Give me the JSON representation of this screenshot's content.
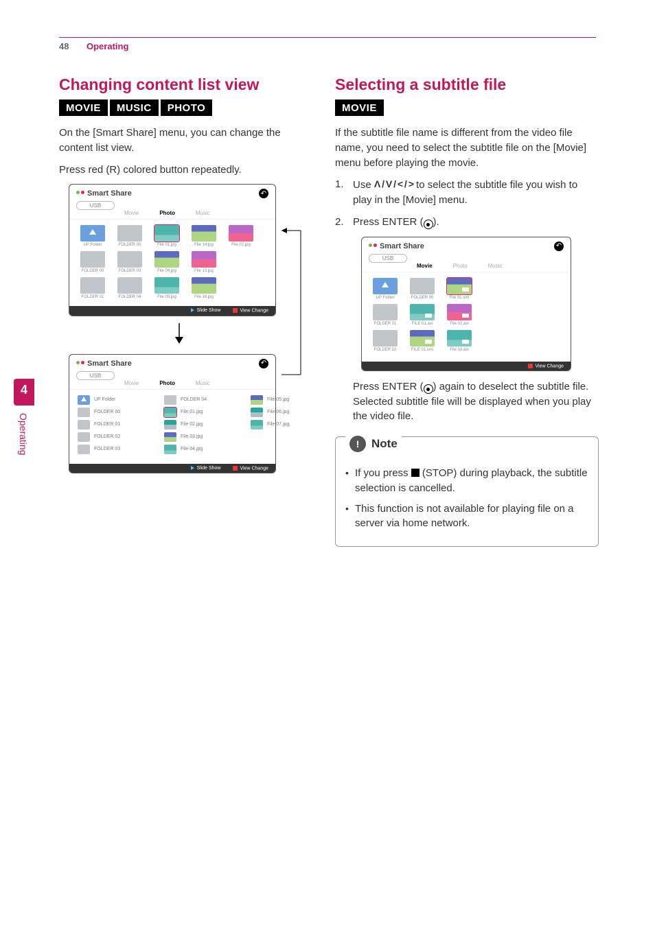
{
  "header": {
    "page": "48",
    "category": "Operating"
  },
  "sidebar": {
    "num": "4",
    "label": "Operating"
  },
  "left": {
    "title": "Changing content list view",
    "tags": [
      "MOVIE",
      "MUSIC",
      "PHOTO"
    ],
    "p1": "On the [Smart Share] menu, you can change the content list view.",
    "p2": "Press red (R) colored button repeatedly."
  },
  "right": {
    "title": "Selecting a subtitle file",
    "tags": [
      "MOVIE"
    ],
    "p1": "If the subtitle file name is different from the video file name, you need to select the subtitle file on the [Movie] menu before playing the movie.",
    "step1a": "Use ",
    "step1_dpad": "Λ / V / < / >",
    "step1b": " to select the subtitle file you wish to play in the [Movie] menu.",
    "step2a": "Press ENTER (",
    "step2b": ").",
    "after1a": "Press ENTER (",
    "after1b": ") again to deselect the subtitle file. Selected subtitle file will be displayed when you play the video file.",
    "note_label": "Note",
    "note1a": "If you press ",
    "note1b": " (STOP) during playback, the subtitle selection is cancelled.",
    "note2": "This function is not available for playing file on a server via home network."
  },
  "ss_common": {
    "title": "Smart Share",
    "usb": "USB",
    "tab_movie": "Movie",
    "tab_photo": "Photo",
    "tab_music": "Music",
    "footer_slide": "Slide Show",
    "footer_change": "View Change"
  },
  "ss1_labels": {
    "up": "UP Folder",
    "f00": "FOLDER 00",
    "f01": "File 01.jpg",
    "f02": "File 14.jpg",
    "f03": "File 07.jpg",
    "r2a": "FOLDER 00",
    "r2b": "FOLDER 03",
    "r2c": "File 04.jpg",
    "r2d": "File 13.jpg",
    "r3a": "FOLDER 01",
    "r3b": "FOLDER 04",
    "r3c": "File 05.jpg",
    "r3d": "File 16.jpg"
  },
  "ss2_labels": {
    "c1": [
      "UP Folder",
      "FOLDER 00",
      "FOLDER 01",
      "FOLDER 02",
      "FOLDER 03"
    ],
    "c2": [
      "FOLDER 04",
      "File 01.jpg",
      "File 02.jpg",
      "File 03.jpg",
      "File 04.jpg"
    ],
    "c3": [
      "File 05.jpg",
      "File 06.jpg",
      "File 07.jpg"
    ]
  },
  "ss3_labels": {
    "up": "UP Folder",
    "f00": "FOLDER 00",
    "f01": "File 01.smi",
    "r2a": "FOLDER 01",
    "r2b": "FILE 01.avi",
    "r2c": "File 02.avi",
    "r3a": "FOLDER 02",
    "r3b": "FILE 01.smi",
    "r3c": "File 03.avi"
  },
  "chart_data": null
}
